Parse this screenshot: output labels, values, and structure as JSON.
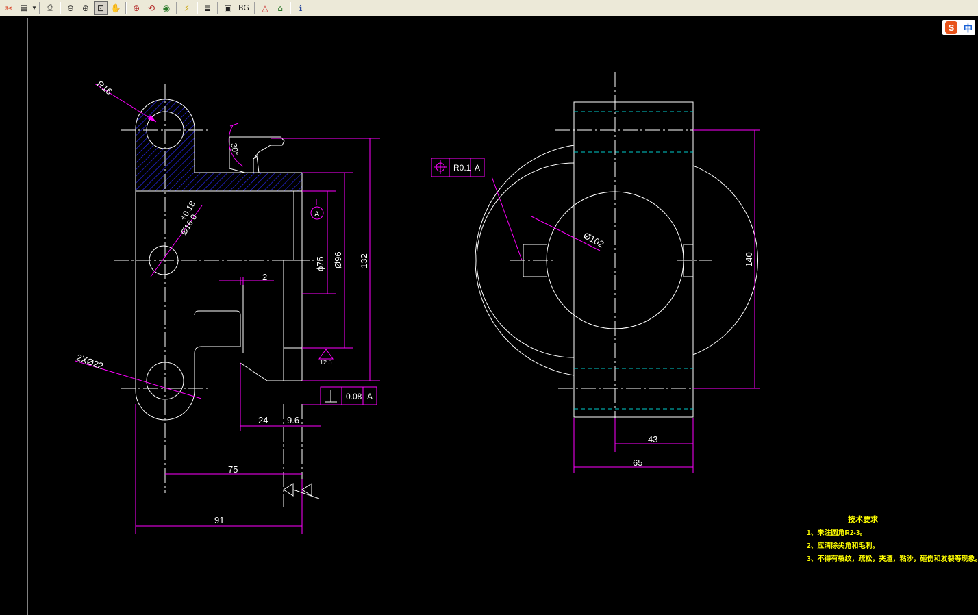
{
  "toolbar": {
    "buttons": [
      {
        "name": "open-icon",
        "glyph": "✂"
      },
      {
        "name": "pages-icon",
        "glyph": "▤"
      },
      {
        "name": "print-icon",
        "glyph": "⎙"
      },
      {
        "name": "zoom-out-icon",
        "glyph": "⊖"
      },
      {
        "name": "zoom-in-icon",
        "glyph": "⊕"
      },
      {
        "name": "zoom-window-icon",
        "glyph": "⊡"
      },
      {
        "name": "pan-icon",
        "glyph": "✋"
      },
      {
        "name": "zoom-extents-icon",
        "glyph": "⊕"
      },
      {
        "name": "zoom-realtime-icon",
        "glyph": "⟲"
      },
      {
        "name": "view-eye-icon",
        "glyph": "◉"
      },
      {
        "name": "layers-icon",
        "glyph": "⚡"
      },
      {
        "name": "stack-icon",
        "glyph": "≣"
      },
      {
        "name": "frame-icon",
        "glyph": "▣"
      },
      {
        "name": "background-button",
        "glyph": "BG"
      },
      {
        "name": "measure-icon",
        "glyph": "△"
      },
      {
        "name": "home-icon",
        "glyph": "⌂"
      },
      {
        "name": "info-icon",
        "glyph": "ℹ"
      }
    ]
  },
  "ime": {
    "logo": "S",
    "lang": "中"
  },
  "colors": {
    "canvas": "#000000",
    "lines": "#ffffff",
    "dims": "#ff00ff",
    "hatch": "#2a2aff",
    "hidden": "#00cccc",
    "notes": "#ffff00"
  },
  "drawing": {
    "front": {
      "r16": "R16",
      "tol_plus": "+0.18",
      "tol_base": "Ø16  0",
      "angle": "30°",
      "datum": "A",
      "d75": "ϕ75",
      "d96": "Ø96",
      "d132": "132",
      "d2": "2",
      "surface": "12.5",
      "holes": "2XØ22",
      "perp_sym": "⊥",
      "perp_val": "0.08",
      "perp_datum": "A",
      "d24": "24",
      "d96b": "9.6",
      "d75b": "75",
      "d91": "91"
    },
    "side": {
      "pos_sym": "⊕",
      "pos_val": "R0.1",
      "pos_datum": "A",
      "d102": "Ø102",
      "d140": "140",
      "d43": "43",
      "d65": "65"
    }
  },
  "notes": {
    "title": "技术要求",
    "items": [
      "1、未注圆角R2-3。",
      "2、应清除尖角和毛刺。",
      "3、不得有裂纹，疏松，夹渣，粘沙，砸伤和发裂等现象。"
    ]
  }
}
